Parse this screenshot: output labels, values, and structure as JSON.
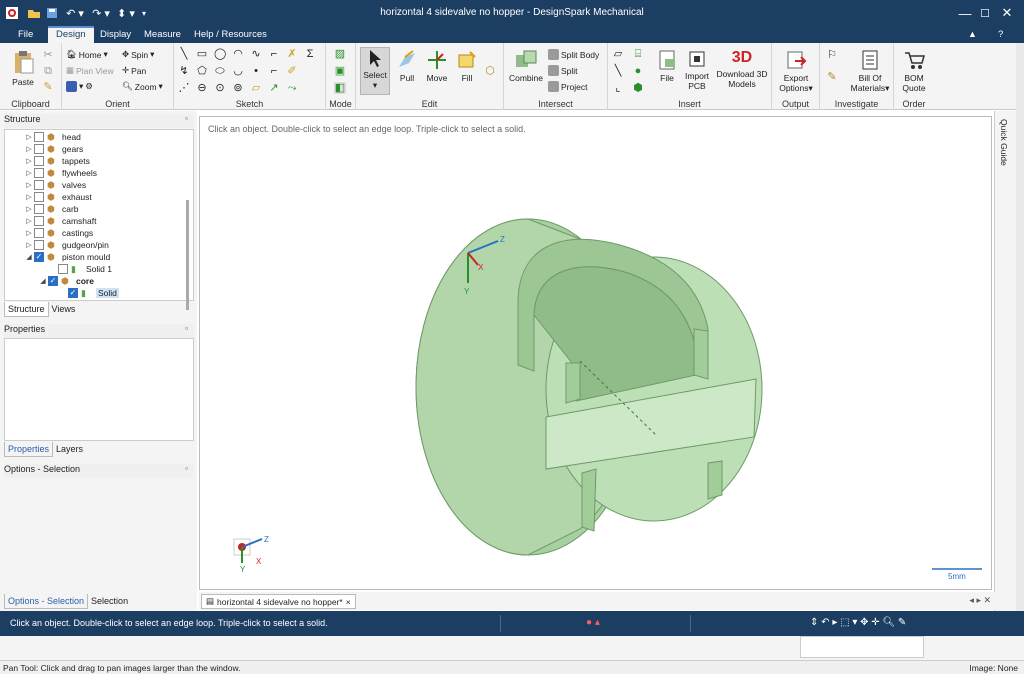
{
  "window": {
    "title": "horizontal 4 sidevalve no hopper - DesignSpark Mechanical"
  },
  "menu": {
    "items": [
      "File",
      "Design",
      "Display",
      "Measure",
      "Help / Resources"
    ],
    "active": "Design"
  },
  "ribbon": {
    "clipboard": {
      "label": "Clipboard",
      "paste": "Paste"
    },
    "orient": {
      "label": "Orient",
      "home": "Home",
      "plan_view": "Plan View",
      "spin": "Spin",
      "pan": "Pan",
      "zoom": "Zoom"
    },
    "sketch": {
      "label": "Sketch"
    },
    "mode": {
      "label": "Mode"
    },
    "edit": {
      "label": "Edit",
      "select": "Select",
      "pull": "Pull",
      "move": "Move",
      "fill": "Fill"
    },
    "intersect": {
      "label": "Intersect",
      "combine": "Combine",
      "split_body": "Split Body",
      "split": "Split",
      "project": "Project"
    },
    "insert": {
      "label": "Insert",
      "file": "File",
      "import_pcb_1": "Import",
      "import_pcb_2": "PCB",
      "download_1": "Download 3D",
      "download_2": "Models",
      "badge_3d": "3D"
    },
    "output": {
      "label": "Output",
      "export_1": "Export",
      "export_2": "Options"
    },
    "investigate": {
      "label": "Investigate",
      "bom_1": "Bill Of",
      "bom_2": "Materials"
    },
    "order": {
      "label": "Order",
      "quote_1": "BOM",
      "quote_2": "Quote"
    }
  },
  "structure": {
    "header": "Structure",
    "items": [
      "head",
      "gears",
      "tappets",
      "flywheels",
      "valves",
      "exhaust",
      "carb",
      "camshaft",
      "castings",
      "gudgeon/pin",
      "piston mould",
      "Solid 1",
      "core",
      "Solid"
    ],
    "tabs": [
      "Structure",
      "Views"
    ]
  },
  "properties": {
    "header": "Properties",
    "tabs": [
      "Properties",
      "Layers"
    ]
  },
  "options": {
    "header": "Options - Selection",
    "tabs": [
      "Options - Selection",
      "Selection"
    ]
  },
  "viewport": {
    "hint": "Click an object. Double-click to select an edge loop. Triple-click to select a solid.",
    "axis_x": "X",
    "axis_y": "Y",
    "axis_z": "Z",
    "scale": "5mm",
    "quick_guide": "Quick Guide"
  },
  "document_tab": {
    "label": "horizontal 4 sidevalve no hopper*",
    "close": "×"
  },
  "status": {
    "message": "Click an object. Double-click to select an edge loop. Triple-click to select a solid."
  },
  "bottom": {
    "left": "Pan Tool: Click and drag to pan images larger than the window.",
    "right": "Image: None"
  },
  "colors": {
    "titlebar": "#1d3e63",
    "model_fill": "#b8d9b0",
    "model_dark": "#8fbc88",
    "accent": "#2b6fc2"
  }
}
